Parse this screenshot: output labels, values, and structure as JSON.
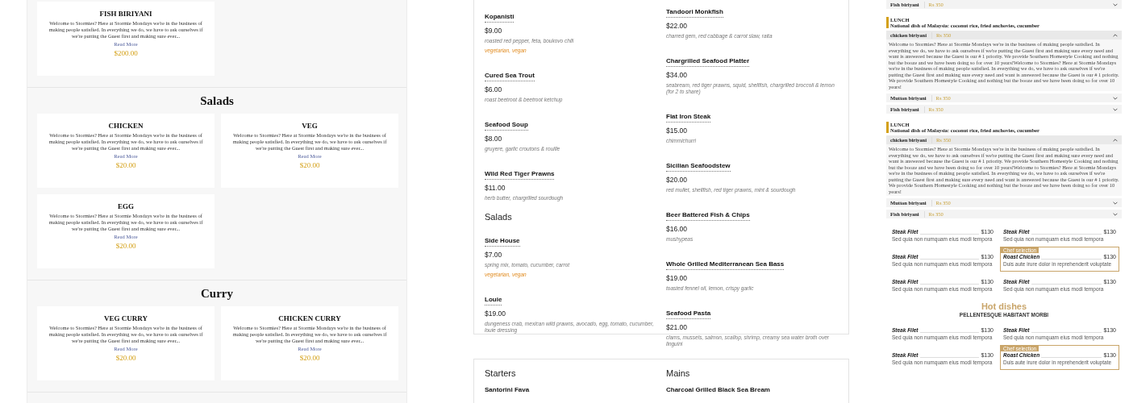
{
  "card_menu": {
    "sections": [
      {
        "items": [
          {
            "name": "FISH BIRIYANI",
            "description": "Welcome to Stormies? Here at Stormie Mondays we're in the business of making people satisfied. In everything we do, we have to ask ourselves if we're putting the Guest first and making sure ever...",
            "link": "Read More",
            "price": "$200.00"
          }
        ]
      },
      {
        "title": "Salads",
        "items": [
          {
            "name": "CHICKEN",
            "description": "Welcome to Stormies? Here at Stormie Mondays we're in the business of making people satisfied. In everything we do, we have to ask ourselves if we're putting the Guest first and making sure ever...",
            "link": "Read More",
            "price": "$20.00"
          },
          {
            "name": "VEG",
            "description": "Welcome to Stormies? Here at Stormie Mondays we're in the business of making people satisfied. In everything we do, we have to ask ourselves if we're putting the Guest first and making sure ever...",
            "link": "Read More",
            "price": "$20.00"
          },
          {
            "name": "EGG",
            "description": "Welcome to Stormies? Here at Stormie Mondays we're in the business of making people satisfied. In everything we do, we have to ask ourselves if we're putting the Guest first and making sure ever...",
            "link": "Read More",
            "price": "$20.00"
          }
        ]
      },
      {
        "title": "Curry",
        "items": [
          {
            "name": "VEG CURRY",
            "description": "Welcome to Stormies? Here at Stormie Mondays we're in the business of making people satisfied. In everything we do, we have to ask ourselves if we're putting the Guest first and making sure ever...",
            "link": "Read More",
            "price": "$20.00"
          },
          {
            "name": "CHICKEN CURRY",
            "description": "Welcome to Stormies? Here at Stormie Mondays we're in the business of making people satisfied. In everything we do, we have to ask ourselves if we're putting the Guest first and making sure ever...",
            "link": "Read More",
            "price": "$20.00"
          }
        ]
      }
    ]
  },
  "list_menu": {
    "columns": [
      {
        "groups": [
          {
            "items": [
              {
                "name": "Kopanisti",
                "price": "$9.00",
                "description": "roasted red pepper, feta, boukovo chili",
                "tags": "vegetarian, vegan"
              },
              {
                "name": "Cured Sea Trout",
                "price": "$6.00",
                "description": "roast beetroot & beetroot ketchup"
              },
              {
                "name": "Seafood Soup",
                "price": "$8.00",
                "description": "gruyere, garlic croutons & rouille"
              },
              {
                "name": "Wild Red Tiger Prawns",
                "price": "$11.00",
                "description": "herb butter, chargrilled sourdough"
              }
            ]
          },
          {
            "heading": "Salads",
            "items": [
              {
                "name": "Side House",
                "price": "$7.00",
                "description": "spring mix, tomato, cucumber, carrot",
                "tags": "vegetarian, vegan"
              },
              {
                "name": "Louie",
                "price": "$19.00",
                "description": "dungeness crab, mexican wild prawns, avocado, egg, tomato, cucumber, louie dressing"
              }
            ]
          }
        ]
      },
      {
        "groups": [
          {
            "items": [
              {
                "name": "Tandoori Monkfish",
                "price": "$22.00",
                "description": "charred gem, red cabbage & carrot slaw, raita"
              },
              {
                "name": "Chargrilled Seafood Platter",
                "price": "$34.00",
                "description": "seabream, red tiger prawns, squid, shellfish, chargrilled broccoli & lemon (for 2 to share)"
              },
              {
                "name": "Flat Iron Steak",
                "price": "$15.00",
                "description": "chimmichurri"
              },
              {
                "name": "Sicilian Seafoodstew",
                "price": "$20.00",
                "description": "red mullet, shellfish, red tiger prawns, mint & sourdough"
              },
              {
                "name": "Beer Battered Fish & Chips",
                "price": "$16.00",
                "description": "mushypeas"
              },
              {
                "name": "Whole Grilled Mediterranean Sea Bass",
                "price": "$19.00",
                "description": "toasted fennel oil, lemon, crispy garlic"
              },
              {
                "name": "Seafood Pasta",
                "price": "$21.00",
                "description": "clams, mussels, salmon, scallop, shrimp, creamy sea water broth over linguini"
              }
            ]
          }
        ]
      }
    ],
    "next_card": {
      "columns": [
        {
          "heading": "Starters",
          "item": "Santorini Fava"
        },
        {
          "heading": "Mains",
          "item": "Charcoal Grilled Black Sea Bream"
        }
      ]
    }
  },
  "accordion_menu": {
    "top_row": {
      "name": "Fish biriyani",
      "price": "Rs 350",
      "expanded": false
    },
    "groups": [
      {
        "label": "LUNCH",
        "subtitle": "National dish of Malaysia: coconut rice, fried anchovies, cucumber",
        "items": [
          {
            "name": "chicken biriyani",
            "price": "Rs 350",
            "expanded": true,
            "body": "Welcome to Stormies? Here at Stormie Mondays we're in the business of making people satisfied. In everything we do, we have to ask ourselves if we're putting the Guest first and making sure every need and want is answered because the Guest is our # 1 priority. We provide Southern Homestyle Cooking and nothing but the booze and we have been doing so for over 10 years!Welcome to Stormies? Here at Stormie Mondays we're in the business of making people satisfied. In everything we do, we have to ask ourselves if we're putting the Guest first and making sure every need and want is answered because the Guest is our # 1 priority. We provide Southern Homestyle Cooking and nothing but the booze and we have been doing so for over 10 years!"
          },
          {
            "name": "Mutton biriyani",
            "price": "Rs 350",
            "expanded": false
          },
          {
            "name": "Fish biriyani",
            "price": "Rs 350",
            "expanded": false
          }
        ]
      },
      {
        "label": "LUNCH",
        "subtitle": "National dish of Malaysia: coconut rice, fried anchovies, cucumber",
        "items": [
          {
            "name": "chicken biriyani",
            "price": "Rs 350",
            "expanded": true,
            "body": "Welcome to Stormies? Here at Stormie Mondays we're in the business of making people satisfied. In everything we do, we have to ask ourselves if we're putting the Guest first and making sure every need and want is answered because the Guest is our # 1 priority. We provide Southern Homestyle Cooking and nothing but the booze and we have been doing so for over 10 years!Welcome to Stormies? Here at Stormie Mondays we're in the business of making people satisfied. In everything we do, we have to ask ourselves if we're putting the Guest first and making sure every need and want is answered because the Guest is our # 1 priority. We provide Southern Homestyle Cooking and nothing but the booze and we have been doing so for over 10 years!"
          },
          {
            "name": "Mutton biriyani",
            "price": "Rs 350",
            "expanded": false
          },
          {
            "name": "Fish biriyani",
            "price": "Rs 350",
            "expanded": false
          }
        ]
      }
    ]
  },
  "grid_menu": {
    "blocks": [
      {
        "items": [
          {
            "name": "Steak Filet",
            "price": "$130",
            "description": "Sed quia non numquam eius modi tempora"
          },
          {
            "name": "Steak Filet",
            "price": "$130",
            "description": "Sed quia non numquam eius modi tempora"
          },
          {
            "name": "Steak Filet",
            "price": "$130",
            "description": "Sed quia non numquam eius modi tempora"
          },
          {
            "name": "Steak Filet",
            "price": "$130",
            "description": "Sed quia non numquam eius modi tempora"
          },
          {
            "name": "Roast Chicken",
            "price": "$130",
            "description": "Duis aute irure dolor in reprehenderit voluptate",
            "badge": "Chef selection"
          },
          {
            "name": "Steak Filet",
            "price": "$130",
            "description": "Sed quia non numquam eius modi tempora"
          }
        ]
      },
      {
        "title": "Hot dishes",
        "subtitle": "PELLENTESQUE HABITANT MORBI",
        "items": [
          {
            "name": "Steak Filet",
            "price": "$130",
            "description": "Sed quia non numquam eius modi tempora"
          },
          {
            "name": "Steak Filet",
            "price": "$130",
            "description": "Sed quia non numquam eius modi tempora"
          },
          {
            "name": "Steak Filet",
            "price": "$130",
            "description": "Sed quia non numquam eius modi tempora"
          },
          {
            "name": "Roast Chicken",
            "price": "$130",
            "description": "Duis aute irure dolor in reprehenderit voluptate",
            "badge": "Chef selection"
          }
        ]
      }
    ]
  }
}
